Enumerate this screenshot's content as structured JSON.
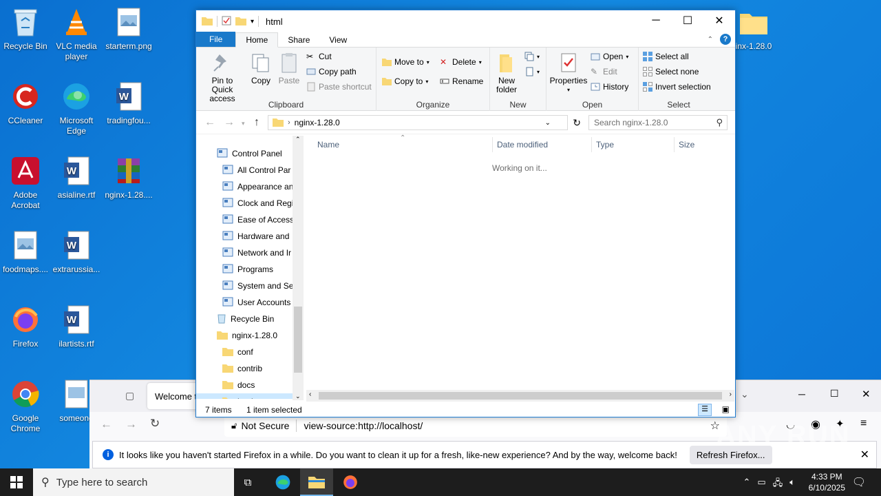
{
  "desktop": {
    "icons": [
      {
        "label": "Recycle Bin"
      },
      {
        "label": "VLC media player"
      },
      {
        "label": "starterm.png"
      },
      {
        "label": "CCleaner"
      },
      {
        "label": "Microsoft Edge"
      },
      {
        "label": "tradingfou..."
      },
      {
        "label": "Adobe Acrobat"
      },
      {
        "label": "asialine.rtf"
      },
      {
        "label": "nginx-1.28...."
      },
      {
        "label": "foodmaps...."
      },
      {
        "label": "extrarussia..."
      },
      {
        "label": "Firefox"
      },
      {
        "label": "ilartists.rtf"
      },
      {
        "label": "Google Chrome"
      },
      {
        "label": "someone"
      },
      {
        "label": "inx-1.28.0"
      }
    ]
  },
  "explorer": {
    "title": "html",
    "tabs": {
      "file": "File",
      "home": "Home",
      "share": "Share",
      "view": "View"
    },
    "help": "?",
    "ribbon": {
      "clipboard": {
        "name": "Clipboard",
        "pin": "Pin to Quick access",
        "copy": "Copy",
        "paste": "Paste",
        "cut": "Cut",
        "copy_path": "Copy path",
        "paste_shortcut": "Paste shortcut"
      },
      "organize": {
        "name": "Organize",
        "move_to": "Move to",
        "copy_to": "Copy to",
        "delete": "Delete",
        "rename": "Rename"
      },
      "new": {
        "name": "New",
        "new_folder": "New folder"
      },
      "open": {
        "name": "Open",
        "properties": "Properties",
        "open": "Open",
        "edit": "Edit",
        "history": "History"
      },
      "select": {
        "name": "Select",
        "select_all": "Select all",
        "select_none": "Select none",
        "invert": "Invert selection"
      }
    },
    "address": {
      "path": "nginx-1.28.0",
      "search_placeholder": "Search nginx-1.28.0"
    },
    "nav": [
      {
        "label": "Control Panel"
      },
      {
        "label": "All Control Par"
      },
      {
        "label": "Appearance an"
      },
      {
        "label": "Clock and Regi"
      },
      {
        "label": "Ease of Access"
      },
      {
        "label": "Hardware and"
      },
      {
        "label": "Network and Ir"
      },
      {
        "label": "Programs"
      },
      {
        "label": "System and Se"
      },
      {
        "label": "User Accounts"
      },
      {
        "label": "Recycle Bin"
      },
      {
        "label": "nginx-1.28.0"
      },
      {
        "label": "conf"
      },
      {
        "label": "contrib"
      },
      {
        "label": "docs"
      },
      {
        "label": "html"
      }
    ],
    "columns": {
      "name": "Name",
      "date": "Date modified",
      "type": "Type",
      "size": "Size"
    },
    "working": "Working on it...",
    "status": {
      "items": "7 items",
      "selected": "1 item selected"
    }
  },
  "firefox": {
    "tab_title": "Welcome t",
    "not_secure": "Not Secure",
    "url": "view-source:http://localhost/",
    "notice": "It looks like you haven't started Firefox in a while. Do you want to clean it up for a fresh, like-new experience? And by the way, welcome back!",
    "refresh_button": "Refresh Firefox..."
  },
  "taskbar": {
    "search_placeholder": "Type here to search",
    "time": "4:33 PM",
    "date": "6/10/2025"
  },
  "watermark": "ANY RUN"
}
